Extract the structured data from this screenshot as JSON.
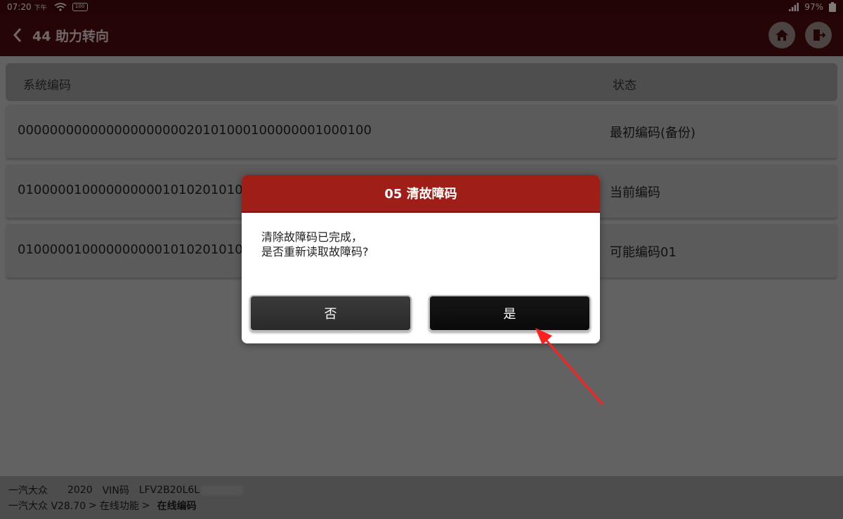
{
  "status_bar": {
    "time": "07:20",
    "ampm": "下午",
    "battery_small": "100",
    "battery_pct": "97%"
  },
  "header": {
    "title": "44 助力转向",
    "buttons": [
      "home-icon",
      "exit-icon"
    ]
  },
  "table": {
    "columns": [
      "系统编码",
      "状态"
    ],
    "rows": [
      {
        "code": "0000000000000000000002010100010000000100010​0",
        "status": "最初编码(备份)"
      },
      {
        "code": "010000010000000000101020101000",
        "status": "当前编码"
      },
      {
        "code": "010000010000000000101020101000",
        "status": "可能编码01"
      }
    ]
  },
  "dialog": {
    "title": "05 清故障码",
    "message_line1": "清除故障码已完成，",
    "message_line2": "是否重新读取故障码?",
    "no_label": "否",
    "yes_label": "是"
  },
  "footer": {
    "brand": "一汽大众",
    "year": "2020",
    "vin_label": "VIN码",
    "vin_value": "LFV2B20L6L",
    "path_brand": "一汽大众 V28.70",
    "path_sep1": ">",
    "path_online": "在线功能",
    "path_sep2": ">",
    "path_current": "在线编码"
  },
  "colors": {
    "header_bg": "#440a0a",
    "dialog_header": "#a01e18",
    "annotation_arrow": "#ff2020"
  }
}
